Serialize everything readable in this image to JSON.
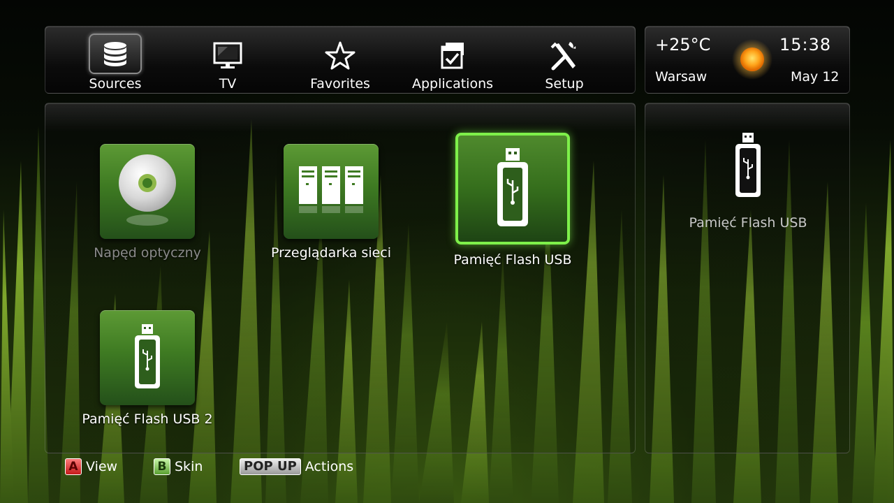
{
  "menu": {
    "items": [
      {
        "label": "Sources",
        "icon": "database-icon"
      },
      {
        "label": "TV",
        "icon": "tv-monitor-icon"
      },
      {
        "label": "Favorites",
        "icon": "star-icon"
      },
      {
        "label": "Applications",
        "icon": "applications-icon"
      },
      {
        "label": "Setup",
        "icon": "tools-icon"
      }
    ],
    "active": "Sources"
  },
  "weather": {
    "temperature": "+25°C",
    "time": "15:38",
    "city": "Warsaw",
    "date": "May 12",
    "icon": "sun-icon"
  },
  "sources": {
    "tiles": [
      {
        "label": "Napęd optyczny",
        "icon": "optical-disc-icon",
        "enabled": false
      },
      {
        "label": "Przeglądarka sieci",
        "icon": "network-servers-icon",
        "enabled": true
      },
      {
        "label": "Pamięć Flash USB",
        "icon": "usb-flash-icon",
        "enabled": true,
        "selected": true
      },
      {
        "label": "Pamięć Flash USB 2",
        "icon": "usb-flash-icon",
        "enabled": true
      }
    ]
  },
  "preview": {
    "label": "Pamięć Flash USB",
    "icon": "usb-flash-icon"
  },
  "footer": {
    "hints": [
      {
        "key": "A",
        "label": "View",
        "color": "#d9302a"
      },
      {
        "key": "B",
        "label": "Skin",
        "color": "#7bc24a"
      },
      {
        "key": "POP UP",
        "label": "Actions",
        "color": "#cccccc"
      }
    ]
  },
  "colors": {
    "accent": "#7ef04a",
    "tile_green": "#3e7a22",
    "disabled_text": "#8a8a8a"
  }
}
